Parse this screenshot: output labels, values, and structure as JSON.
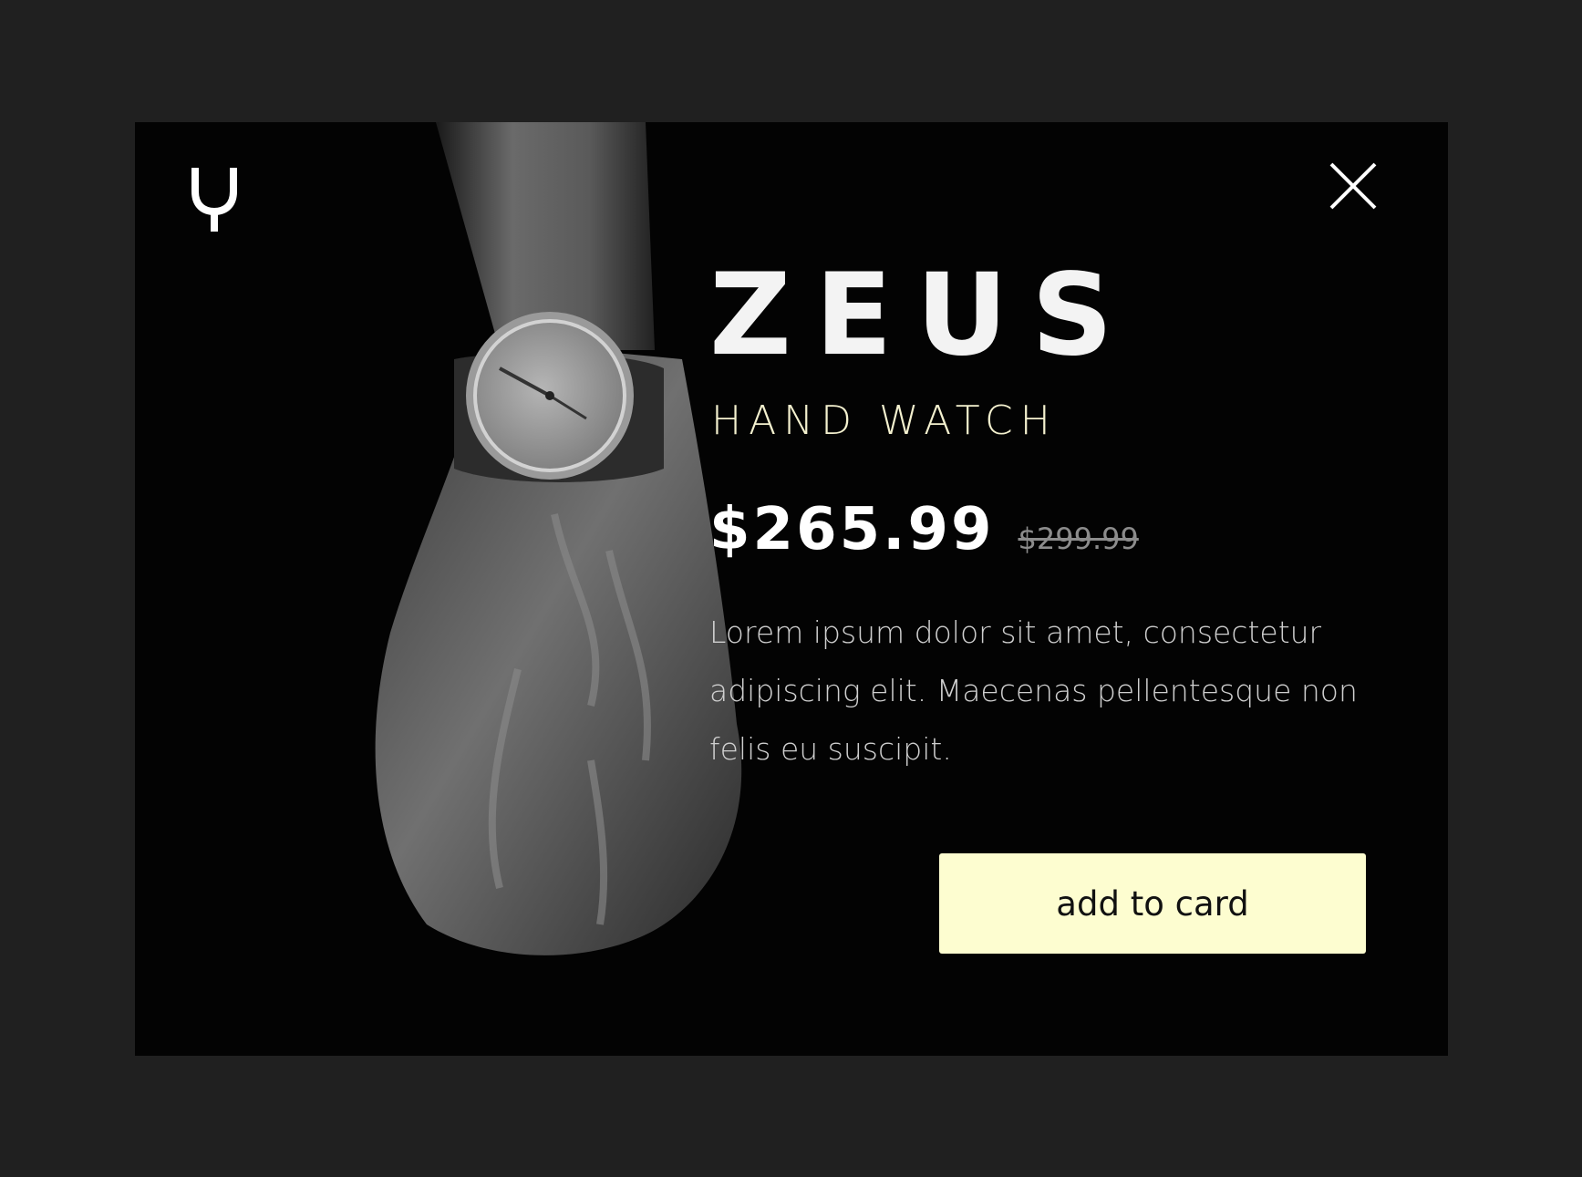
{
  "brand": {
    "logo_icon": "trident-y-logo-icon"
  },
  "modal": {
    "close_icon": "close-x-icon",
    "product": {
      "name": "ZEUS",
      "subtitle": "HAND WATCH",
      "price": "$265.99",
      "old_price": "$299.99",
      "description": "Lorem ipsum dolor sit amet, consectetur adipiscing elit. Maecenas pellentesque non felis eu suscipit.",
      "image": "wrist-watch-photo"
    },
    "cta_label": "add to card"
  },
  "colors": {
    "page_bg": "#202020",
    "modal_bg": "#030303",
    "accent": "#fdfdd0",
    "subtitle": "#f4f1cf",
    "muted": "#8c8c8c"
  }
}
